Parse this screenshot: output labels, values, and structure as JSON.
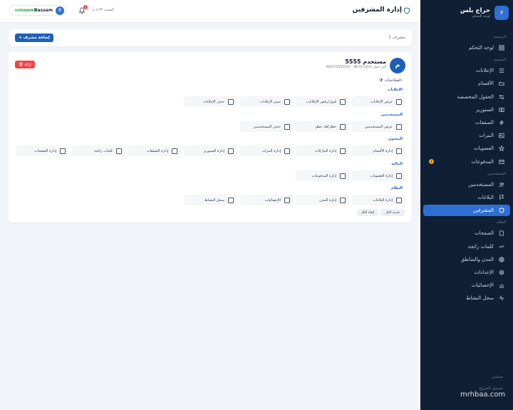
{
  "brand": {
    "name": "حراج بلس",
    "subtitle": "لوحة التحكم"
  },
  "sidebar": {
    "sections": [
      {
        "title": "الرئيسية",
        "items": [
          {
            "label": "لوحة التحكم",
            "icon": "grid-icon"
          }
        ]
      },
      {
        "title": "المحتوى",
        "items": [
          {
            "label": "الإعلانات",
            "icon": "list-icon"
          },
          {
            "label": "الأقسام",
            "icon": "folder-icon"
          },
          {
            "label": "الحقول المخصصة",
            "icon": "sliders-icon"
          },
          {
            "label": "الستوريز",
            "icon": "book-icon"
          },
          {
            "label": "الصفقات",
            "icon": "bolt-icon"
          },
          {
            "label": "البنرات",
            "icon": "image-icon"
          },
          {
            "label": "العضويات",
            "icon": "star-icon"
          },
          {
            "label": "المدفوعات",
            "icon": "card-icon",
            "badge": "2"
          }
        ]
      },
      {
        "title": "المستخدمين",
        "items": [
          {
            "label": "المستخدمين",
            "icon": "users-icon"
          },
          {
            "label": "البلاغات",
            "icon": "flag-icon"
          },
          {
            "label": "المشرفين",
            "icon": "shield-icon",
            "active": true
          }
        ]
      },
      {
        "title": "النظام",
        "items": [
          {
            "label": "الصفحات",
            "icon": "page-icon"
          },
          {
            "label": "كلمات رائجة",
            "icon": "trend-icon"
          },
          {
            "label": "المدن والمناطق",
            "icon": "globe-icon"
          },
          {
            "label": "الإعدادات",
            "icon": "gear-icon"
          },
          {
            "label": "الإحصائيات",
            "icon": "chart-icon"
          },
          {
            "label": "سجل النشاط",
            "icon": "activity-icon"
          }
        ]
      }
    ],
    "footer": [
      "حسابي",
      "تسجيل الخروج"
    ]
  },
  "header": {
    "title": "إدارة المشرفين",
    "date": "السبت ٤:٣٢ م",
    "notifications": "3",
    "user": {
      "initial": "B",
      "name": "Bassam",
      "status": "SUPERADMIN"
    }
  },
  "toolbar": {
    "add_label": "+ إضافة مشرف",
    "count": "1 مشرف"
  },
  "card": {
    "initial": "م",
    "name": "مستخدم 5555",
    "meta": "966570555555 · آخر دخول 2025-02-08",
    "remove_label": "🗑 إزالة",
    "perm_heading": "🛡 الصلاحيات:",
    "groups": [
      {
        "label": "الإعلانات",
        "items": [
          "عرض الإعلانات",
          "قبول/رفض الإعلانات",
          "تمييز الإعلانات",
          "حذف الإعلانات"
        ]
      },
      {
        "label": "المستخدمين",
        "items": [
          "عرض المستخدمين",
          "حظر/فك حظر",
          "حذف المستخدمين"
        ]
      },
      {
        "label": "المحتوى",
        "items": [
          "إدارة الأقسام",
          "إدارة الماركات",
          "إدارة البنرات",
          "إدارة الستوريز",
          "إدارة الصفقات",
          "كلمات رائجة",
          "إدارة الصفحات"
        ]
      },
      {
        "label": "المالية",
        "items": [
          "إدارة العضويات",
          "إدارة المدفوعات"
        ]
      },
      {
        "label": "النظام",
        "items": [
          "إدارة البلاغات",
          "إدارة المدن",
          "الإحصائيات",
          "سجل النشاط"
        ]
      }
    ],
    "select_all": "تحديد الكل",
    "deselect_all": "إلغاء الكل"
  },
  "watermark": "mrhbaa.com"
}
